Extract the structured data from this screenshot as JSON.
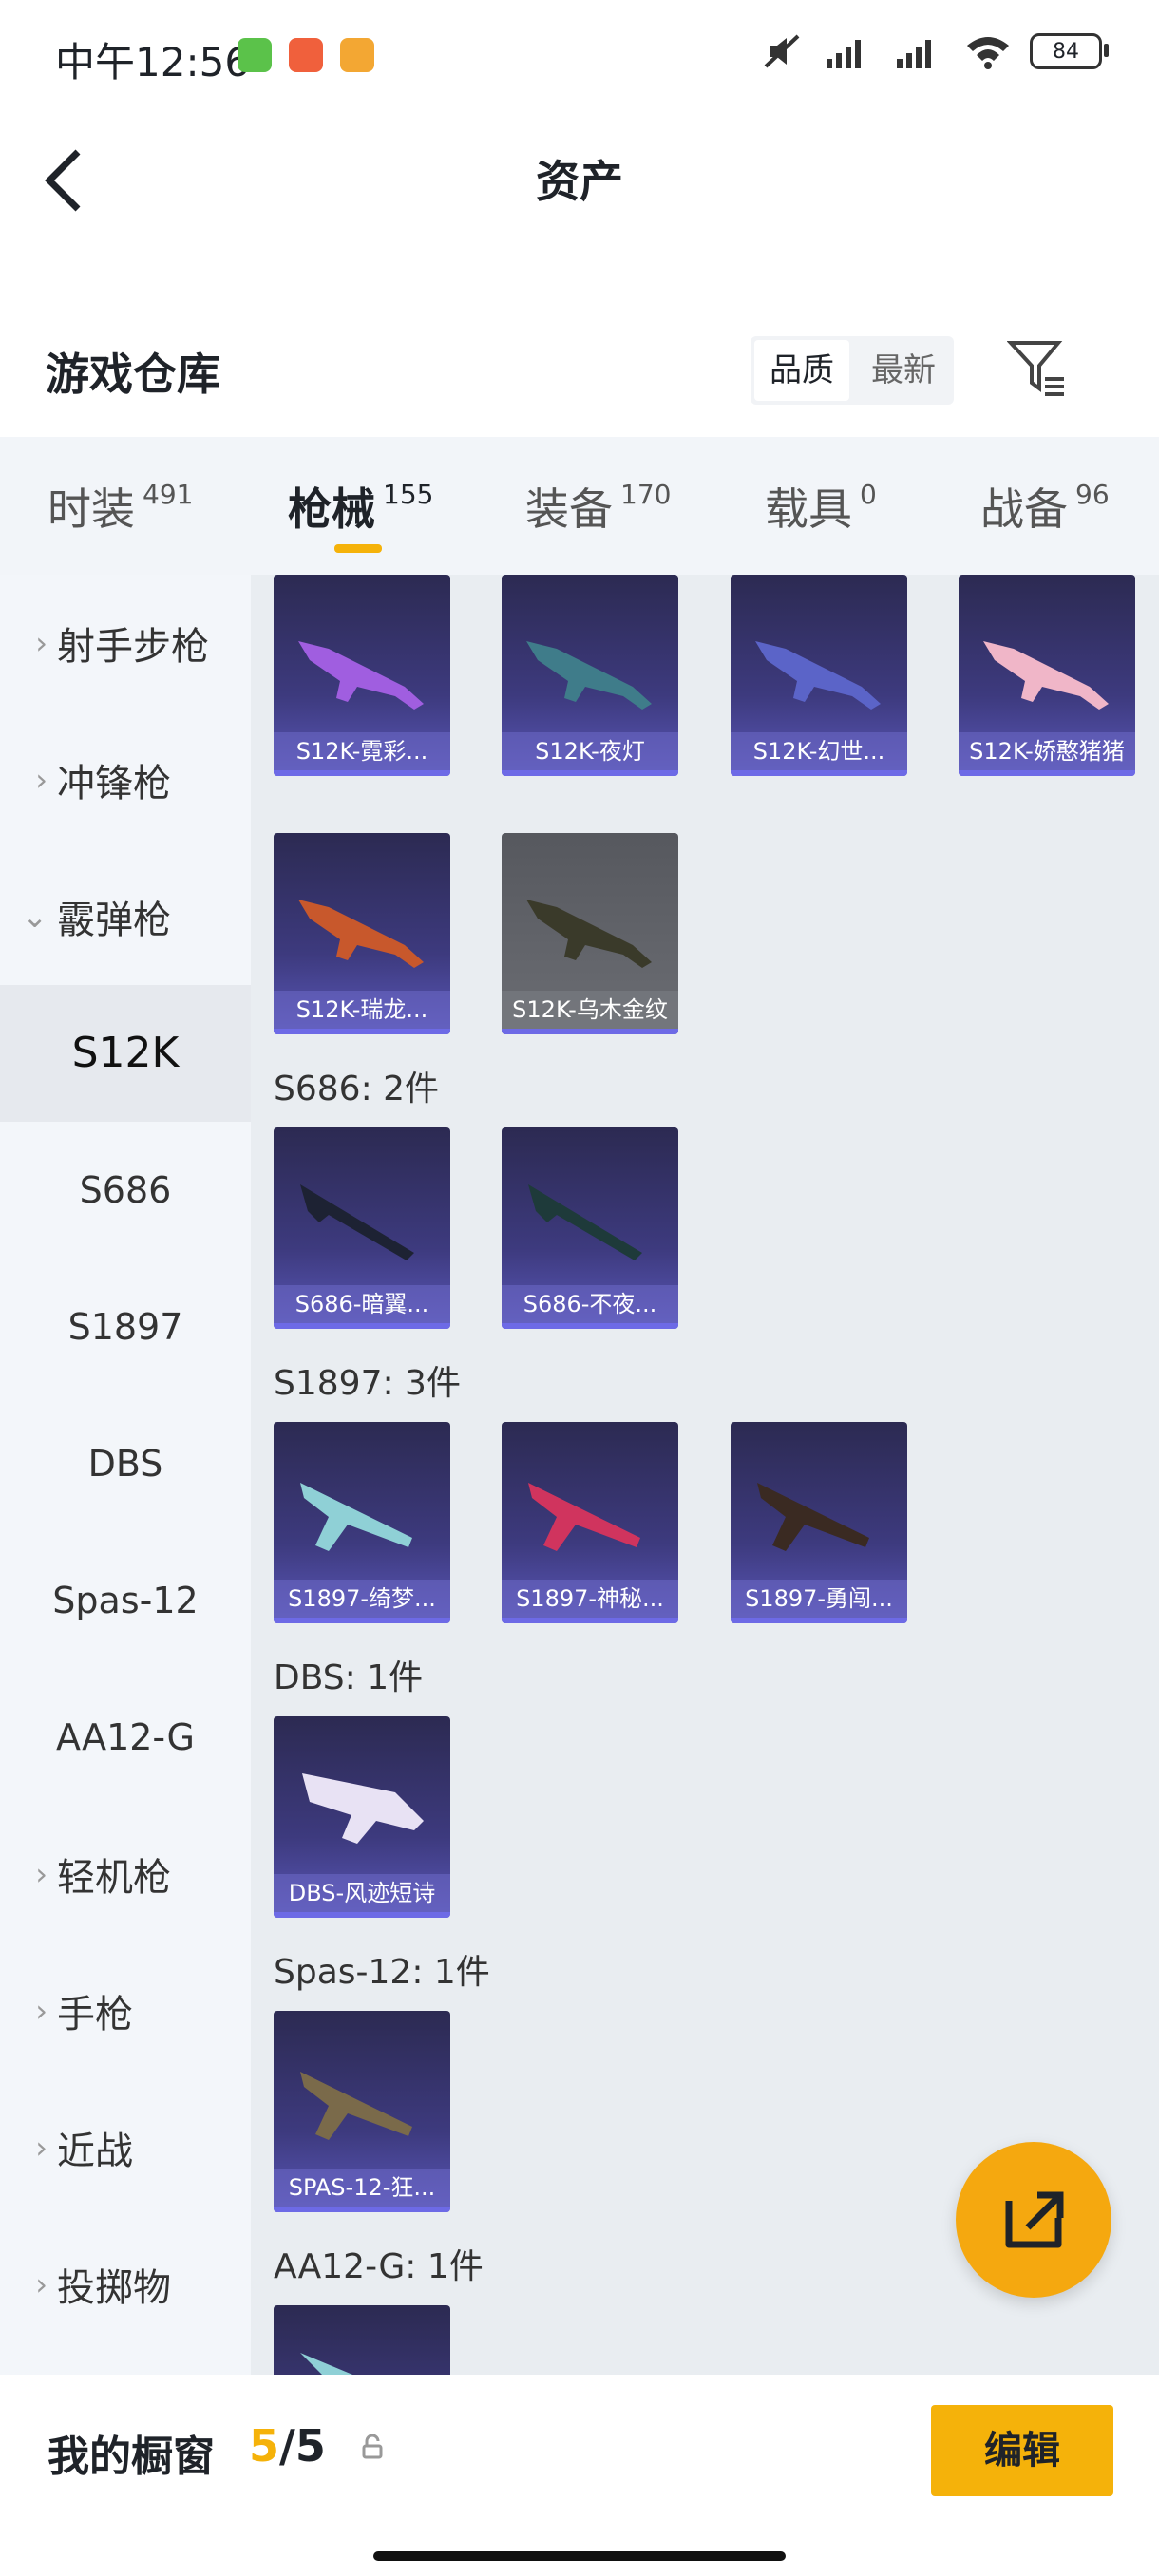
{
  "status_bar": {
    "time": "中午12:56",
    "battery": "84"
  },
  "header": {
    "title": "资产"
  },
  "section": {
    "title": "游戏仓库",
    "sort_options": [
      "品质",
      "最新"
    ],
    "active_sort": "品质"
  },
  "tabs": [
    {
      "label": "时装",
      "count": "491"
    },
    {
      "label": "枪械",
      "count": "155"
    },
    {
      "label": "装备",
      "count": "170"
    },
    {
      "label": "载具",
      "count": "0"
    },
    {
      "label": "战备",
      "count": "96"
    }
  ],
  "active_tab": "枪械",
  "sidebar": {
    "categories_top": [
      "射手步枪",
      "冲锋枪",
      "霰弹枪"
    ],
    "subitems": [
      "S12K",
      "S686",
      "S1897",
      "DBS",
      "Spas-12",
      "AA12-G"
    ],
    "categories_bottom": [
      "轻机枪",
      "手枪",
      "近战",
      "投掷物"
    ]
  },
  "groups": {
    "s12k_items": [
      "S12K-霓彩...",
      "S12K-夜灯",
      "S12K-幻世...",
      "S12K-娇憨猪猪",
      "S12K-瑞龙...",
      "S12K-乌木金纹"
    ],
    "s686_title": "S686: 2件",
    "s686_items": [
      "S686-暗翼...",
      "S686-不夜..."
    ],
    "s1897_title": "S1897: 3件",
    "s1897_items": [
      "S1897-绮梦...",
      "S1897-神秘...",
      "S1897-勇闯..."
    ],
    "dbs_title": "DBS: 1件",
    "dbs_items": [
      "DBS-风迹短诗"
    ],
    "spas_title": "Spas-12: 1件",
    "spas_items": [
      "SPAS-12-狂..."
    ],
    "aa12_title": "AA12-G: 1件"
  },
  "showcase": {
    "label": "我的橱窗",
    "current": "5",
    "separator": "/",
    "max": "5",
    "edit_label": "编辑"
  },
  "colors": {
    "accent": "#f5b20a",
    "card_purple": "#3d3a7e",
    "fab": "#f5a80f"
  }
}
